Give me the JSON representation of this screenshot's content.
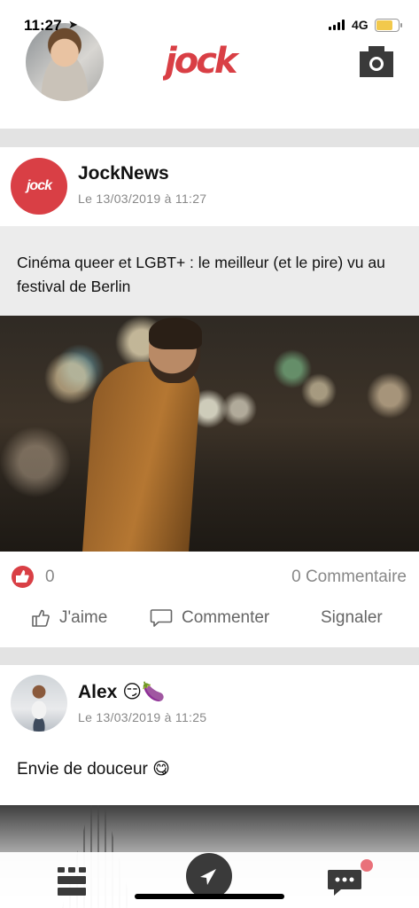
{
  "status_bar": {
    "time": "11:27",
    "network": "4G"
  },
  "header": {
    "logo_text": "jock",
    "camera_icon": "camera-icon"
  },
  "posts": [
    {
      "author": "JockNews",
      "date": "Le 13/03/2019 à 11:27",
      "avatar_text": "jock",
      "title": "Cinéma queer et LGBT+ : le meilleur (et le pire) vu au festival de Berlin",
      "likes": "0",
      "comments": "0 Commentaire",
      "actions": {
        "like": "J'aime",
        "comment": "Commenter",
        "report": "Signaler"
      }
    },
    {
      "author": "Alex 😏🍆",
      "date": "Le 13/03/2019 à 11:25",
      "text": "Envie de douceur 😋"
    }
  ],
  "colors": {
    "brand": "#d93f45",
    "separator": "#e3e3e3",
    "title_bg": "#ececec",
    "notification_dot": "#e9717a"
  }
}
